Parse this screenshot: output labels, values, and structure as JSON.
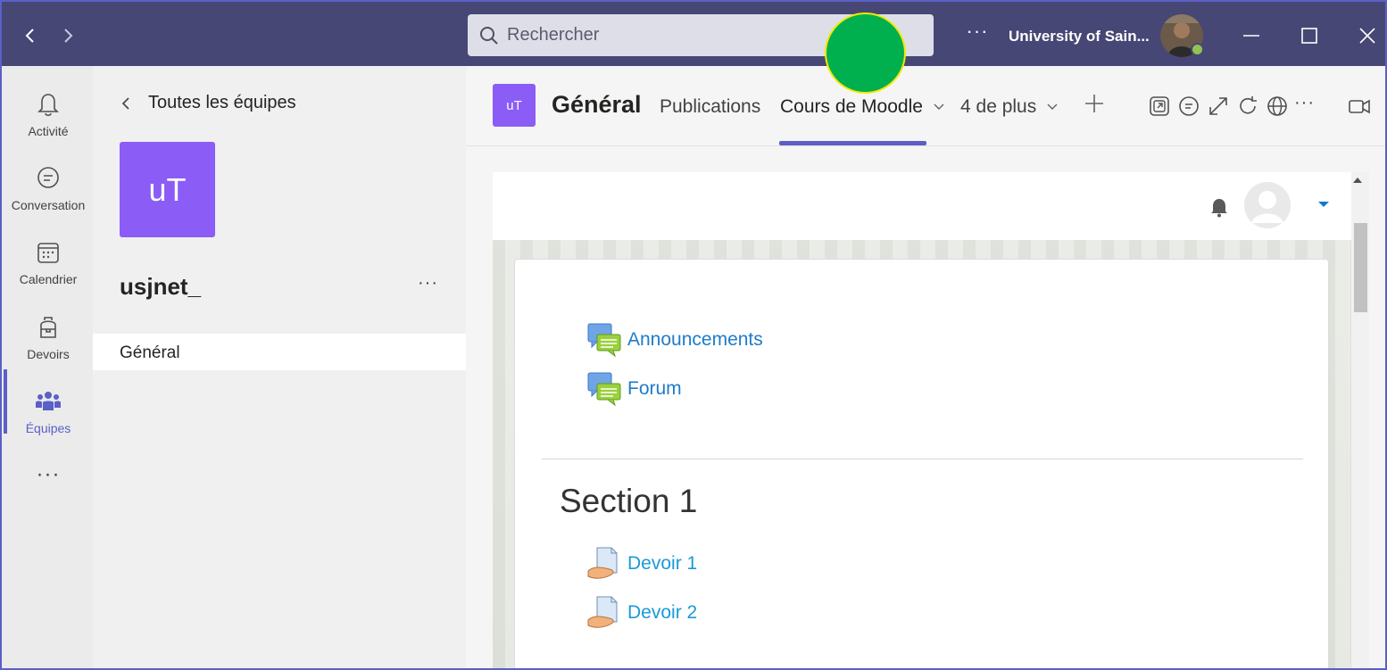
{
  "titlebar": {
    "search_placeholder": "Rechercher",
    "more_label": "···",
    "org_name": "University of Sain...",
    "presence": "available"
  },
  "rail": {
    "items": [
      {
        "label": "Activité",
        "icon": "bell-icon"
      },
      {
        "label": "Conversation",
        "icon": "chat-icon"
      },
      {
        "label": "Calendrier",
        "icon": "calendar-icon"
      },
      {
        "label": "Devoirs",
        "icon": "backpack-icon"
      },
      {
        "label": "Équipes",
        "icon": "teams-icon",
        "active": true
      }
    ],
    "more_label": "···"
  },
  "team_panel": {
    "back_label": "Toutes les équipes",
    "team_initials": "uT",
    "team_name": "usjnet_",
    "more_label": "···",
    "channels": [
      {
        "label": "Général",
        "selected": true
      }
    ]
  },
  "header": {
    "channel_initials": "uT",
    "channel_name": "Général",
    "tabs": [
      {
        "label": "Publications",
        "active": false
      },
      {
        "label": "Cours de Moodle",
        "active": true,
        "has_dropdown": true
      },
      {
        "label": "4 de plus",
        "active": false,
        "has_dropdown": true
      }
    ],
    "more_label": "···",
    "icons": [
      "popout-icon",
      "conversation-icon",
      "expand-icon",
      "refresh-icon",
      "globe-icon",
      "more-icon",
      "meet-icon"
    ]
  },
  "moodle": {
    "activities_top": [
      {
        "label": "Announcements",
        "type": "forum"
      },
      {
        "label": "Forum",
        "type": "forum"
      }
    ],
    "section_title": "Section 1",
    "section_activities": [
      {
        "label": "Devoir 1",
        "type": "assignment"
      },
      {
        "label": "Devoir 2",
        "type": "assignment"
      }
    ]
  },
  "colors": {
    "titlebar": "#464775",
    "accent": "#5b5fc7",
    "team_tile": "#8b5cf6",
    "link": "#1f7bc8",
    "overlay_dot": "#00b04f"
  }
}
